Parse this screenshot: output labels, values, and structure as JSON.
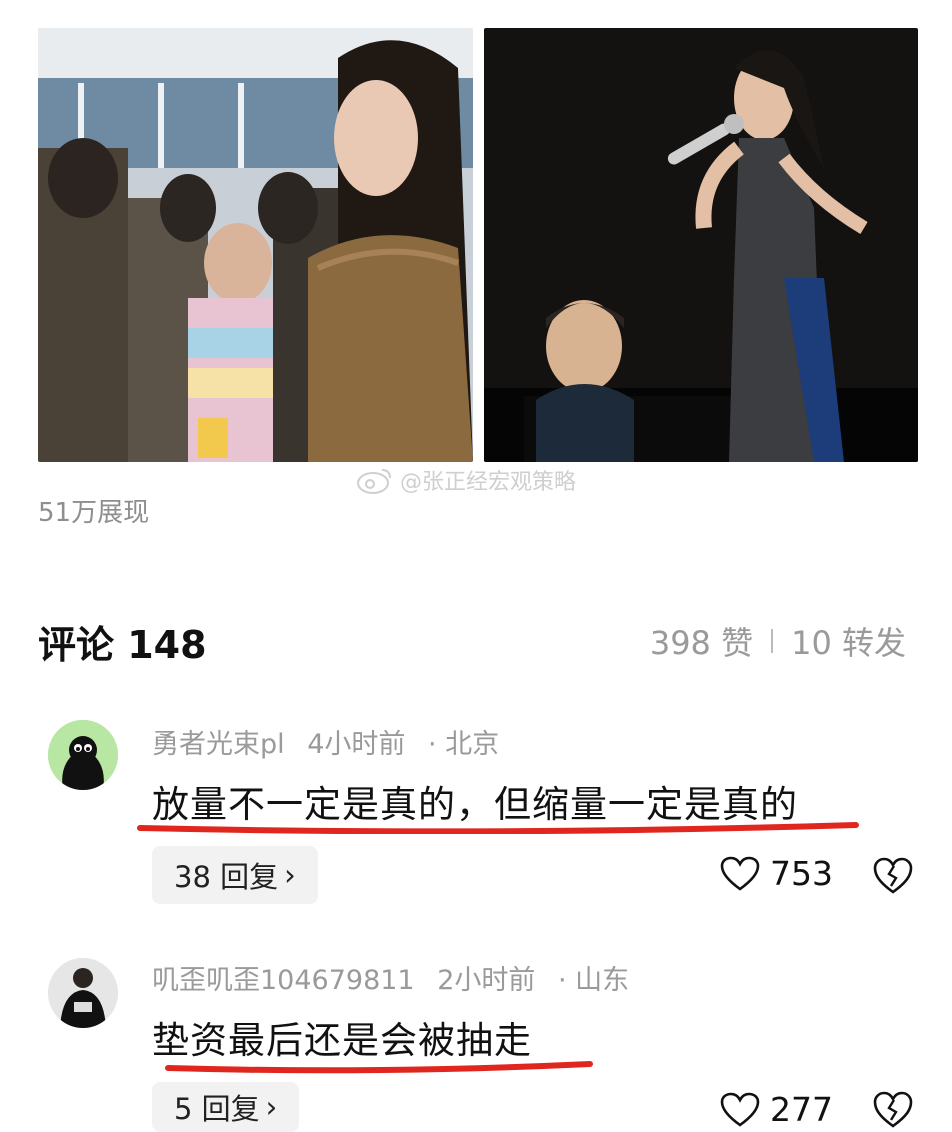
{
  "post": {
    "images": [
      {
        "name": "photo-office-crowd"
      },
      {
        "name": "photo-stage-singer-pianist"
      }
    ],
    "watermark": "@张正经宏观策略",
    "views": "51万展现"
  },
  "comments_header": {
    "title": "评论 148",
    "likes": "398 赞",
    "shares": "10 转发"
  },
  "comments": [
    {
      "username": "勇者光束pl",
      "time": "4小时前",
      "location": "· 北京",
      "text": "放量不一定是真的，但缩量一定是真的",
      "reply_label": "38 回复",
      "like_count": "753"
    },
    {
      "username": "叽歪叽歪104679811",
      "time": "2小时前",
      "location": "· 山东",
      "text": "垫资最后还是会被抽走",
      "reply_label": "5 回复",
      "like_count": "277"
    }
  ],
  "colors": {
    "underline": "#e0271f",
    "meta": "#9a9a9a",
    "reply_bg": "#f2f2f2"
  }
}
